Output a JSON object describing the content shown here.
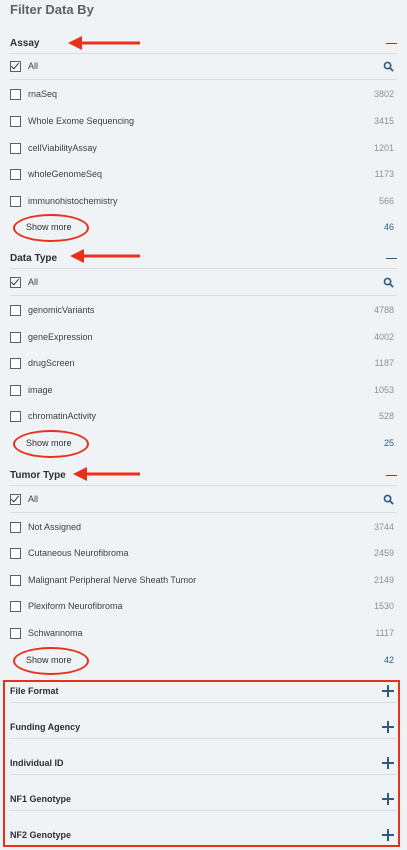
{
  "panel": {
    "title": "Filter Data By"
  },
  "sections": [
    {
      "label": "Assay",
      "all_label": "All",
      "items": [
        {
          "label": "rnaSeq",
          "count": "3802"
        },
        {
          "label": "Whole Exome Sequencing",
          "count": "3415"
        },
        {
          "label": "cellViabilityAssay",
          "count": "1201"
        },
        {
          "label": "wholeGenomeSeq",
          "count": "1173"
        },
        {
          "label": "immunohistochemistry",
          "count": "566"
        }
      ],
      "show_more": "Show more",
      "total": "46"
    },
    {
      "label": "Data Type",
      "all_label": "All",
      "items": [
        {
          "label": "genomicVariants",
          "count": "4788"
        },
        {
          "label": "geneExpression",
          "count": "4002"
        },
        {
          "label": "drugScreen",
          "count": "1187"
        },
        {
          "label": "image",
          "count": "1053"
        },
        {
          "label": "chromatinActivity",
          "count": "528"
        }
      ],
      "show_more": "Show more",
      "total": "25"
    },
    {
      "label": "Tumor Type",
      "all_label": "All",
      "items": [
        {
          "label": "Not Assigned",
          "count": "3744"
        },
        {
          "label": "Cutaneous Neurofibroma",
          "count": "2459"
        },
        {
          "label": "Malignant Peripheral Nerve Sheath Tumor",
          "count": "2149"
        },
        {
          "label": "Plexiform Neurofibroma",
          "count": "1530"
        },
        {
          "label": "Schwannoma",
          "count": "1117"
        }
      ],
      "show_more": "Show more",
      "total": "42"
    }
  ],
  "collapsed_sections": [
    {
      "label": "File Format"
    },
    {
      "label": "Funding Agency"
    },
    {
      "label": "Individual ID"
    },
    {
      "label": "NF1 Genotype"
    },
    {
      "label": "NF2 Genotype"
    }
  ],
  "colors": {
    "accent": "#2c5d86",
    "annotation": "#e8311a",
    "background": "#f0f3f6"
  },
  "icons": {
    "search": "search-icon",
    "collapse": "minus-icon",
    "expand": "plus-icon"
  }
}
